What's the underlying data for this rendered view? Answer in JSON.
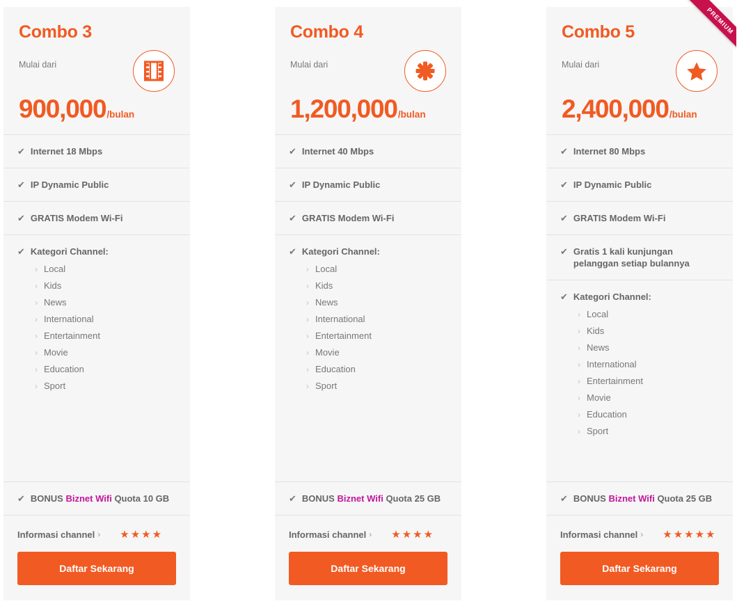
{
  "page": {
    "brand_orange": "#f15a22",
    "ribbon_color": "#c8104d",
    "wifi_brand_color": "#c2169b",
    "card_bg": "#f6f6f6"
  },
  "plans": [
    {
      "title": "Combo 3",
      "price_prefix": "Mulai dari",
      "price_amount": "900,000",
      "price_period": "/bulan",
      "icon": "film-strip-icon",
      "ribbon": null,
      "features": [
        "Internet 18 Mbps",
        "IP Dynamic Public",
        "GRATIS Modem Wi-Fi"
      ],
      "extra_feature": null,
      "category_label": "Kategori Channel:",
      "categories": [
        "Local",
        "Kids",
        "News",
        "International",
        "Entertainment",
        "Movie",
        "Education",
        "Sport"
      ],
      "bonus": {
        "prefix": "BONUS",
        "brand": "Biznet Wifi",
        "suffix": "Quota 10 GB"
      },
      "info_label": "Informasi channel",
      "info_chevron": "›",
      "rating": 4,
      "cta_label": "Daftar Sekarang"
    },
    {
      "title": "Combo 4",
      "price_prefix": "Mulai dari",
      "price_amount": "1,200,000",
      "price_period": "/bulan",
      "icon": "asterisk-icon",
      "ribbon": null,
      "features": [
        "Internet 40 Mbps",
        "IP Dynamic Public",
        "GRATIS Modem Wi-Fi"
      ],
      "extra_feature": null,
      "category_label": "Kategori Channel:",
      "categories": [
        "Local",
        "Kids",
        "News",
        "International",
        "Entertainment",
        "Movie",
        "Education",
        "Sport"
      ],
      "bonus": {
        "prefix": "BONUS",
        "brand": "Biznet Wifi",
        "suffix": "Quota 25 GB"
      },
      "info_label": "Informasi channel",
      "info_chevron": "›",
      "rating": 4,
      "cta_label": "Daftar Sekarang"
    },
    {
      "title": "Combo 5",
      "price_prefix": "Mulai dari",
      "price_amount": "2,400,000",
      "price_period": "/bulan",
      "icon": "star-icon",
      "ribbon": "PREMIUM",
      "features": [
        "Internet 80 Mbps",
        "IP Dynamic Public",
        "GRATIS Modem Wi-Fi"
      ],
      "extra_feature": "Gratis 1 kali kunjungan pelanggan setiap bulannya",
      "category_label": "Kategori Channel:",
      "categories": [
        "Local",
        "Kids",
        "News",
        "International",
        "Entertainment",
        "Movie",
        "Education",
        "Sport"
      ],
      "bonus": {
        "prefix": "BONUS",
        "brand": "Biznet Wifi",
        "suffix": "Quota 25 GB"
      },
      "info_label": "Informasi channel",
      "info_chevron": "›",
      "rating": 5,
      "cta_label": "Daftar Sekarang"
    }
  ],
  "glyphs": {
    "check": "✔",
    "star": "★",
    "sub_chevron": "›"
  }
}
